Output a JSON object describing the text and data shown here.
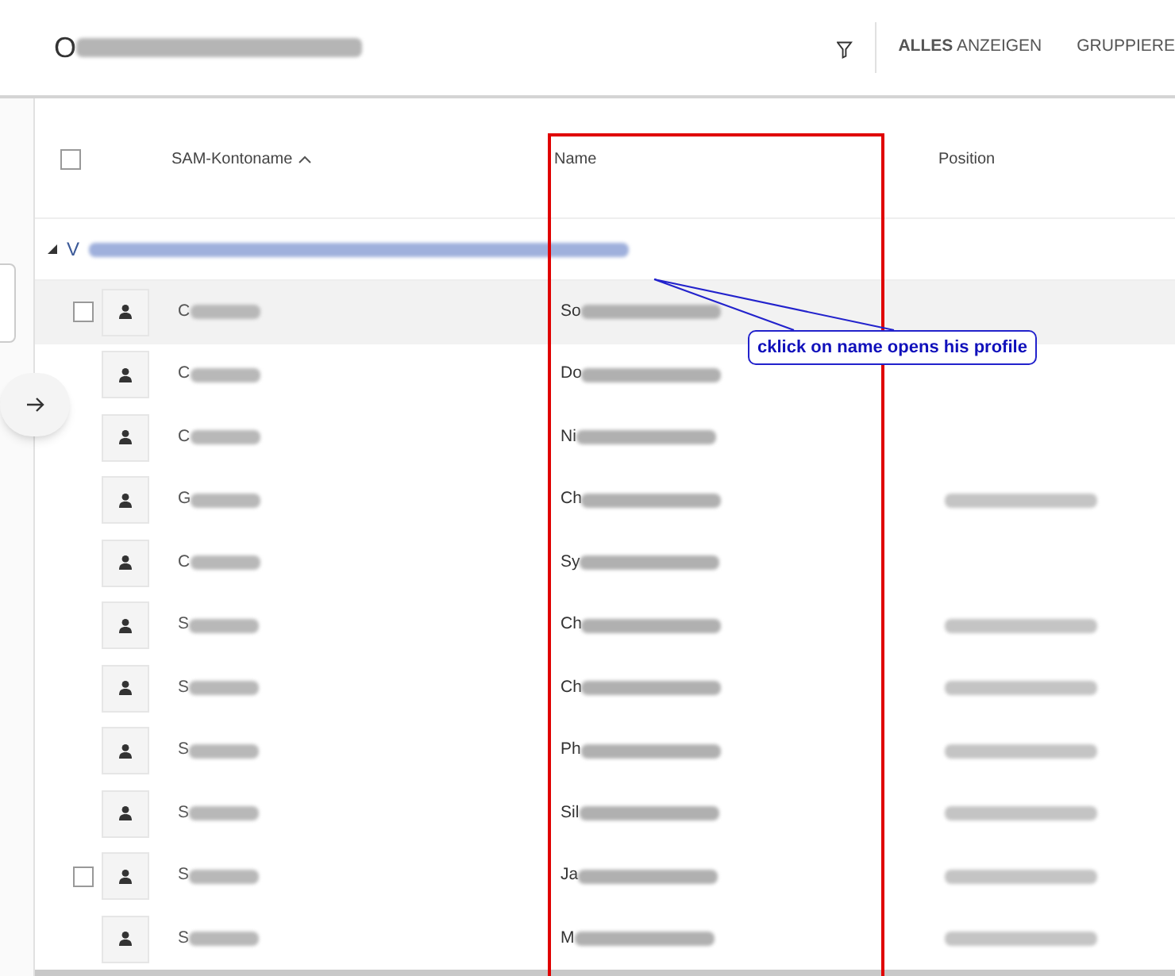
{
  "header": {
    "title_visible": "O",
    "filter": true,
    "actions": [
      {
        "label": "**ALLES** ANZEIGEN"
      },
      {
        "label": "GRUPPIERE"
      }
    ]
  },
  "table": {
    "select_all": {
      "checked": false
    },
    "columns": [
      {
        "label": "SAM-Kontoname",
        "sorted": true
      },
      {
        "label": "Name",
        "sorted": false
      },
      {
        "label": "Position",
        "sorted": false
      }
    ],
    "group": {
      "label_visible": "V",
      "expanded": true
    },
    "rows": [
      {
        "kind": "with-checkbox",
        "sam": "C",
        "name": "So",
        "position_shown": false,
        "checked": false,
        "hovered": true
      },
      {
        "kind": "plain",
        "sam": "C",
        "name": "Do",
        "position_shown": false,
        "hovered": false
      },
      {
        "kind": "plain",
        "sam": "C",
        "name": "Ni",
        "position_shown": false,
        "hovered": false
      },
      {
        "kind": "plain",
        "sam": "G",
        "name": "Ch",
        "position_shown": true,
        "hovered": false
      },
      {
        "kind": "plain",
        "sam": "C",
        "name": "Sy",
        "position_shown": false,
        "hovered": false
      },
      {
        "kind": "plain",
        "sam": "S",
        "name": "Ch",
        "position_shown": true,
        "hovered": false
      },
      {
        "kind": "plain",
        "sam": "S",
        "name": "Ch",
        "position_shown": true,
        "hovered": false
      },
      {
        "kind": "plain",
        "sam": "S",
        "name": "Ph",
        "position_shown": true,
        "hovered": false
      },
      {
        "kind": "plain",
        "sam": "S",
        "name": "Sil",
        "position_shown": true,
        "hovered": false
      },
      {
        "kind": "with-checkbox",
        "sam": "S",
        "name": "Ja",
        "position_shown": true,
        "checked": false,
        "hovered": false
      },
      {
        "kind": "plain",
        "sam": "S",
        "name": "M",
        "position_shown": true,
        "hovered": false
      }
    ]
  },
  "annotation": {
    "text": "cklick on name opens his profile"
  }
}
